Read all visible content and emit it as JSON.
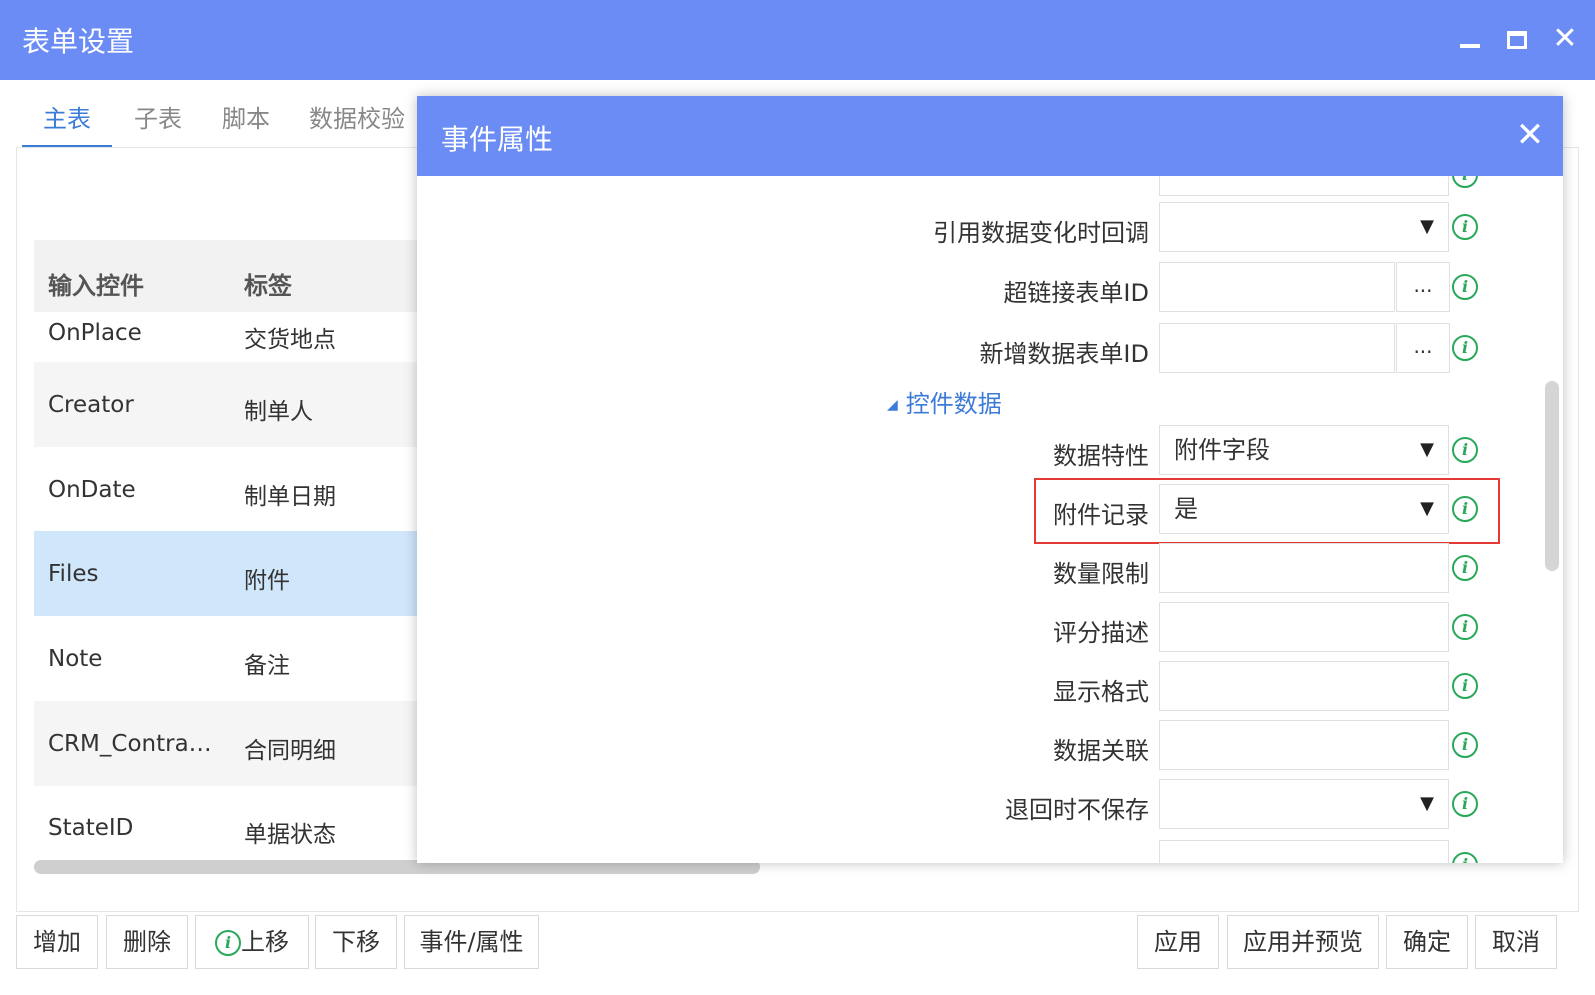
{
  "window": {
    "title": "表单设置",
    "minimize_label": "",
    "maximize_label": "",
    "close_label": "✕"
  },
  "tabs": [
    {
      "label": "主表",
      "active": true
    },
    {
      "label": "子表",
      "active": false
    },
    {
      "label": "脚本",
      "active": false
    },
    {
      "label": "数据校验",
      "active": false
    }
  ],
  "grid": {
    "headers": [
      "输入控件",
      "标签"
    ],
    "rows": [
      {
        "control": "OnPlace",
        "label": "交货地点"
      },
      {
        "control": "Creator",
        "label": "制单人"
      },
      {
        "control": "OnDate",
        "label": "制单日期"
      },
      {
        "control": "Files",
        "label": "附件",
        "selected": true
      },
      {
        "control": "Note",
        "label": "备注"
      },
      {
        "control": "CRM_Contra…",
        "label": "合同明细"
      },
      {
        "control": "StateID",
        "label": "单据状态"
      }
    ]
  },
  "toolbar": {
    "add": "增加",
    "delete": "删除",
    "move_up": "上移",
    "move_down": "下移",
    "event_props": "事件/属性",
    "apply": "应用",
    "apply_preview": "应用并预览",
    "ok": "确定",
    "cancel": "取消"
  },
  "dialog": {
    "title": "事件属性",
    "close_label": "✕",
    "section": "控件数据",
    "properties": [
      {
        "label": "引用数据变化时回调",
        "value": "",
        "type": "select"
      },
      {
        "label": "超链接表单ID",
        "value": "",
        "type": "lookup",
        "button": "..."
      },
      {
        "label": "新增数据表单ID",
        "value": "",
        "type": "lookup",
        "button": "..."
      },
      {
        "label": "数据特性",
        "value": "附件字段",
        "type": "select"
      },
      {
        "label": "附件记录",
        "value": "是",
        "type": "select",
        "highlighted": true
      },
      {
        "label": "数量限制",
        "value": "",
        "type": "text"
      },
      {
        "label": "评分描述",
        "value": "",
        "type": "text"
      },
      {
        "label": "显示格式",
        "value": "",
        "type": "text"
      },
      {
        "label": "数据关联",
        "value": "",
        "type": "text"
      },
      {
        "label": "退回时不保存",
        "value": "",
        "type": "select"
      }
    ]
  },
  "colors": {
    "accent": "#6b8cf5",
    "tab_active": "#3d7bd8",
    "info_green": "#2aa85a",
    "highlight_red": "#e53935",
    "selected_row": "#cfe6fb"
  }
}
